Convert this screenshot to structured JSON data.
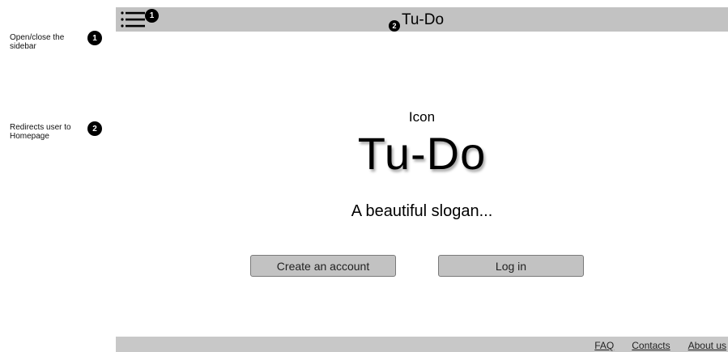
{
  "annotations": [
    {
      "number": "1",
      "text": "Open/close the sidebar"
    },
    {
      "number": "2",
      "text": "Redirects user to Homepage"
    }
  ],
  "header": {
    "title": "Tu-Do",
    "menu_icon": "hamburger-menu-icon"
  },
  "hero": {
    "icon_label": "Icon",
    "title": "Tu-Do",
    "slogan": "A beautiful slogan..."
  },
  "actions": {
    "create_account_label": "Create an account",
    "login_label": "Log in"
  },
  "footer": {
    "links": [
      "FAQ",
      "Contacts",
      "About us"
    ]
  },
  "colors": {
    "bar_gray": "#c2c2c2",
    "button_gray": "#c2c2c2",
    "marker_black": "#000000"
  }
}
